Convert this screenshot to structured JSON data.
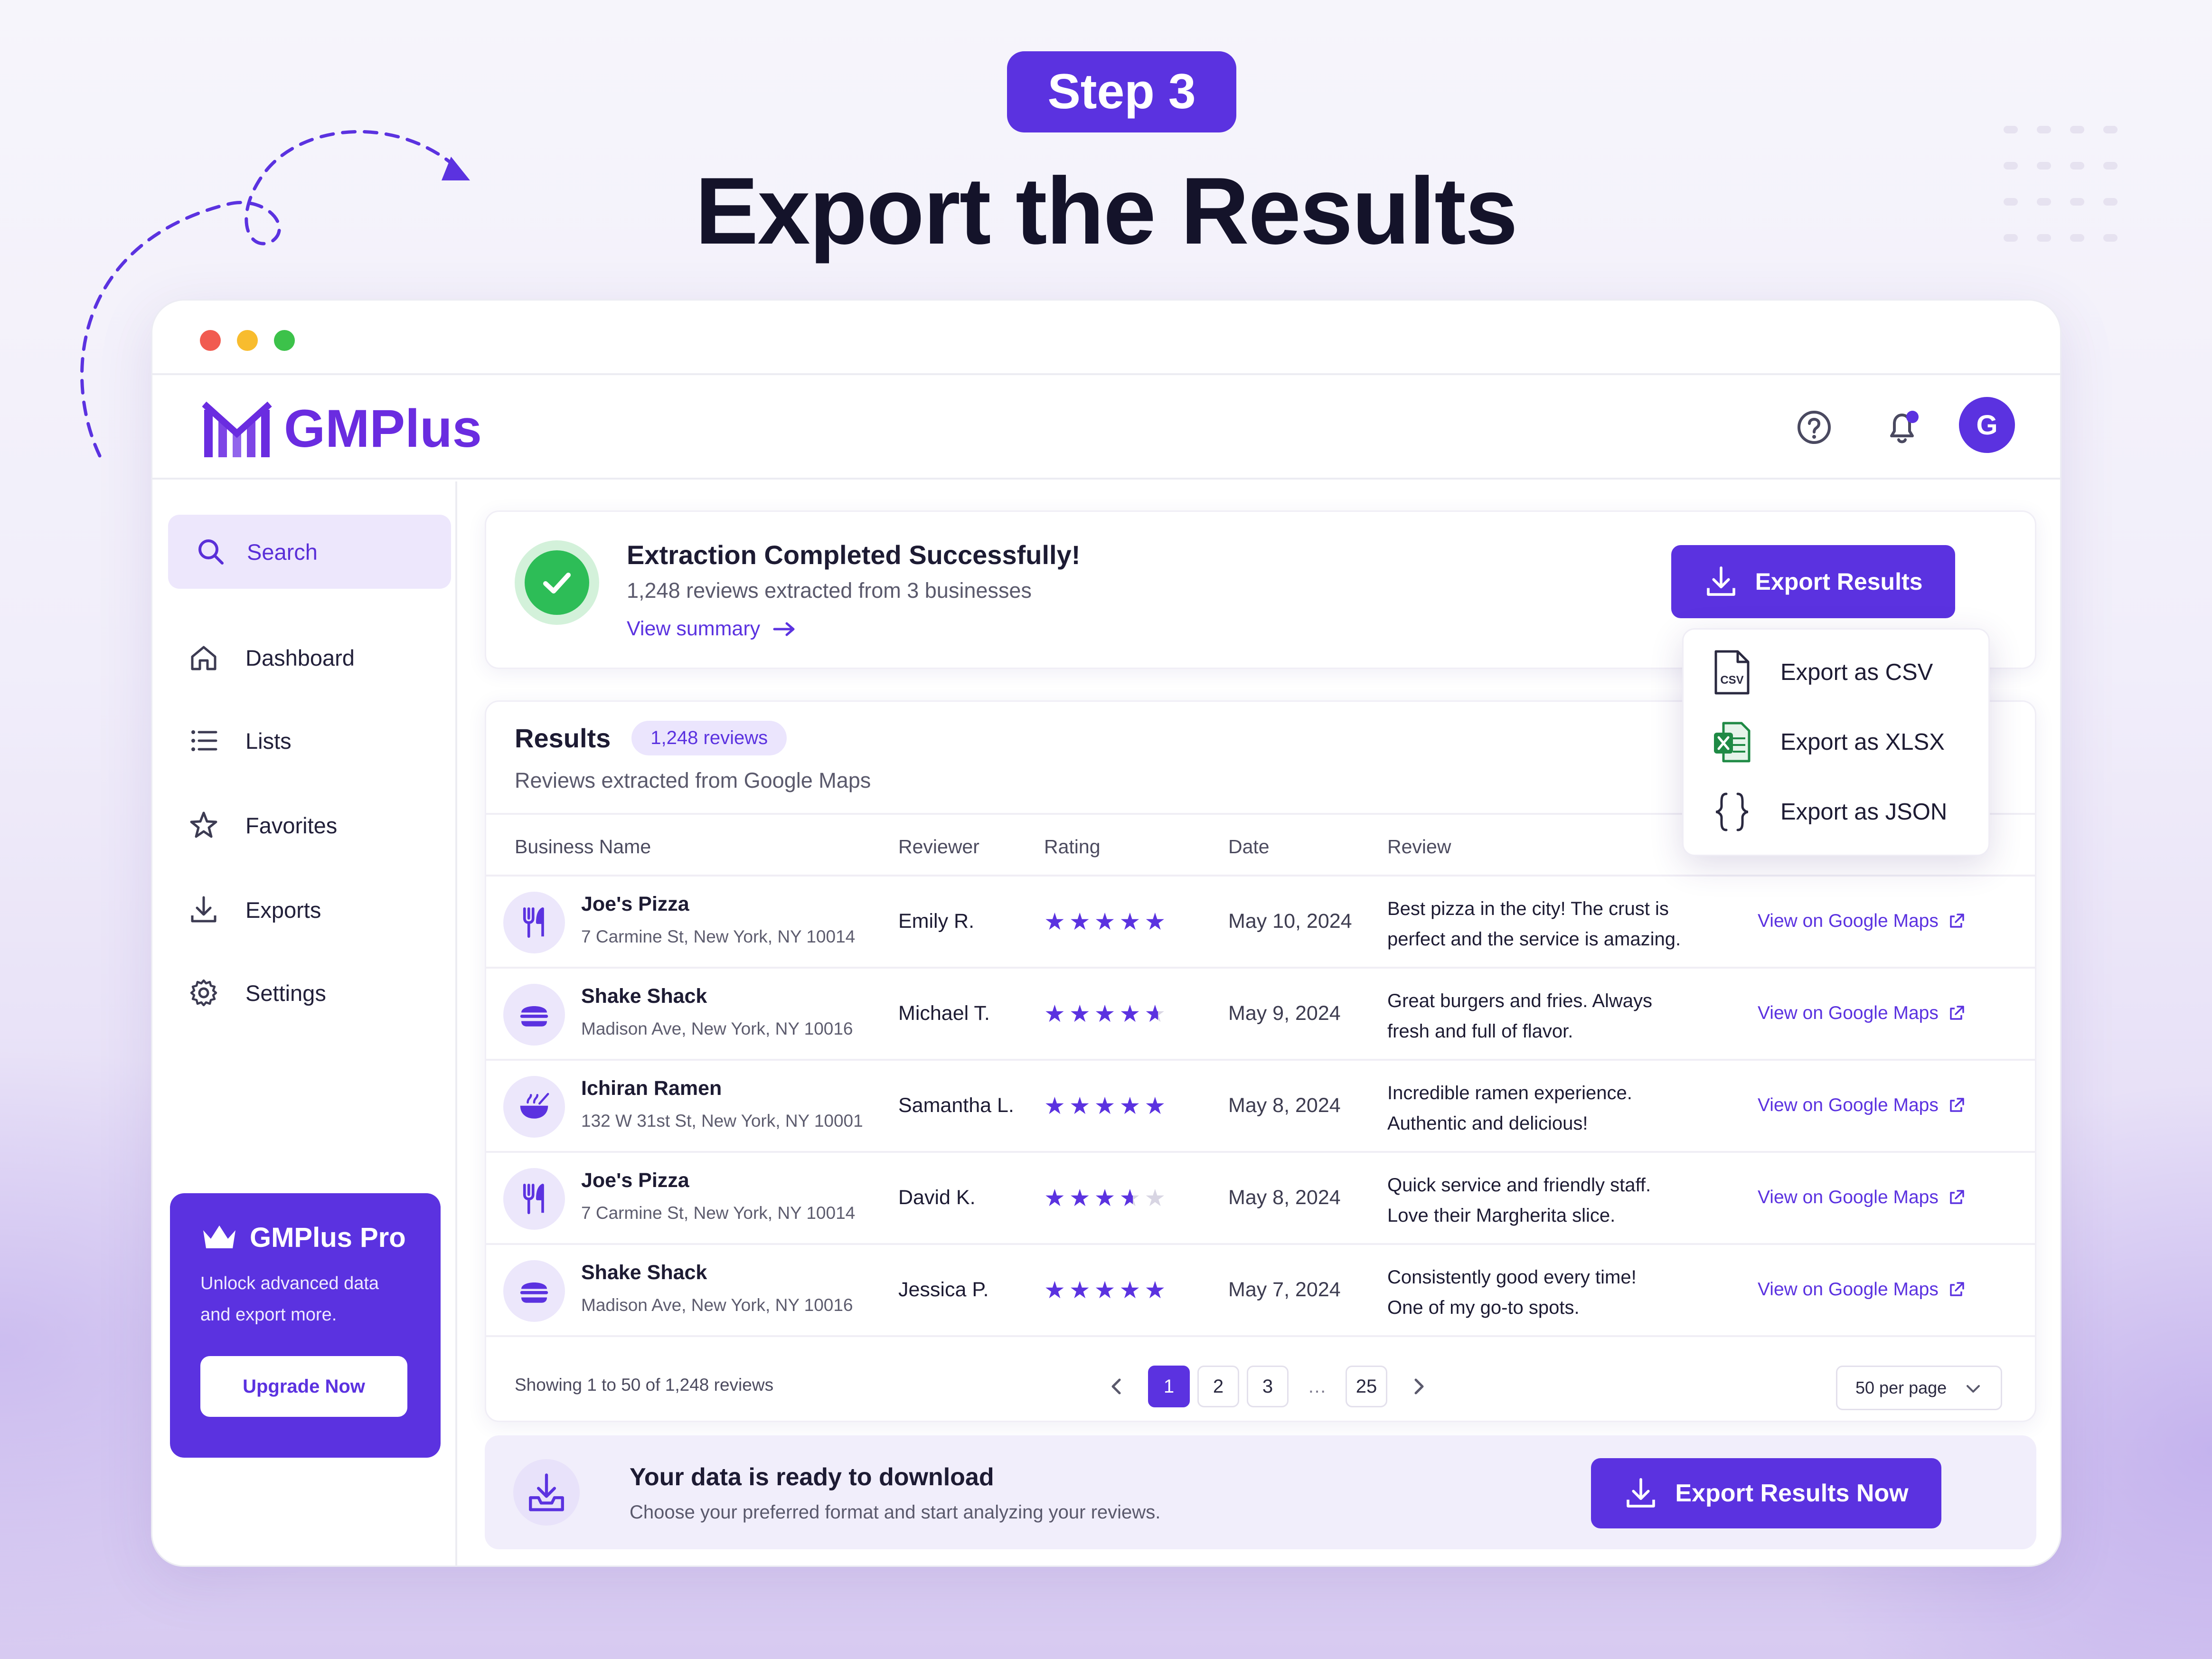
{
  "step_badge": "Step 3",
  "main_title": "Export the Results",
  "app": {
    "name": "GMPlus",
    "avatar_initial": "G"
  },
  "colors": {
    "accent": "#5b32e0",
    "success": "#2dbd57",
    "notification_dot": "#5b32e0"
  },
  "sidebar": {
    "search_label": "Search",
    "items": [
      {
        "label": "Dashboard",
        "icon": "home-icon"
      },
      {
        "label": "Lists",
        "icon": "list-icon"
      },
      {
        "label": "Favorites",
        "icon": "star-icon"
      },
      {
        "label": "Exports",
        "icon": "download-icon"
      },
      {
        "label": "Settings",
        "icon": "gear-icon"
      }
    ],
    "pro": {
      "title": "GMPlus Pro",
      "subtitle_line1": "Unlock advanced data",
      "subtitle_line2": "and export more.",
      "button": "Upgrade Now"
    }
  },
  "success": {
    "title": "Extraction Completed Successfully!",
    "subtitle": "1,248 reviews extracted from 3 businesses",
    "link": "View summary",
    "export_button": "Export Results"
  },
  "export_menu": {
    "items": [
      {
        "label": "Export as CSV",
        "icon": "csv-file-icon"
      },
      {
        "label": "Export as XLSX",
        "icon": "xlsx-file-icon"
      },
      {
        "label": "Export as JSON",
        "icon": "json-braces-icon"
      }
    ]
  },
  "results": {
    "title": "Results",
    "badge": "1,248 reviews",
    "subtitle": "Reviews extracted from Google Maps",
    "columns": [
      "Business Name",
      "Reviewer",
      "Rating",
      "Date",
      "Review"
    ],
    "rows": [
      {
        "business": "Joe's Pizza",
        "address": "7 Carmine St, New York, NY 10014",
        "icon": "utensils-icon",
        "reviewer": "Emily R.",
        "rating": 5,
        "date": "May 10, 2024",
        "review_line1": "Best pizza in the city! The crust is",
        "review_line2": "perfect and the service is amazing.",
        "link": "View on Google Maps"
      },
      {
        "business": "Shake Shack",
        "address": "Madison Ave, New York, NY 10016",
        "icon": "burger-icon",
        "reviewer": "Michael T.",
        "rating": 4.5,
        "date": "May 9, 2024",
        "review_line1": "Great burgers and fries. Always",
        "review_line2": "fresh and full of flavor.",
        "link": "View on Google Maps"
      },
      {
        "business": "Ichiran Ramen",
        "address": "132 W 31st St, New York, NY 10001",
        "icon": "ramen-bowl-icon",
        "reviewer": "Samantha L.",
        "rating": 5,
        "date": "May 8, 2024",
        "review_line1": "Incredible ramen experience.",
        "review_line2": "Authentic and delicious!",
        "link": "View on Google Maps"
      },
      {
        "business": "Joe's Pizza",
        "address": "7 Carmine St, New York, NY 10014",
        "icon": "utensils-icon",
        "reviewer": "David K.",
        "rating": 3.5,
        "date": "May 8, 2024",
        "review_line1": "Quick service and friendly staff.",
        "review_line2": "Love their Margherita slice.",
        "link": "View on Google Maps"
      },
      {
        "business": "Shake Shack",
        "address": "Madison Ave, New York, NY 10016",
        "icon": "burger-icon",
        "reviewer": "Jessica P.",
        "rating": 5,
        "date": "May 7, 2024",
        "review_line1": "Consistently good every time!",
        "review_line2": "One of my go-to spots.",
        "link": "View on Google Maps"
      }
    ],
    "showing": "Showing 1 to 50 of 1,248 reviews",
    "pages": [
      "1",
      "2",
      "3",
      "…",
      "25"
    ],
    "current_page": "1",
    "per_page": "50 per page"
  },
  "banner": {
    "title": "Your data is ready to download",
    "subtitle": "Choose your preferred format and start analyzing your reviews.",
    "button": "Export Results Now"
  }
}
